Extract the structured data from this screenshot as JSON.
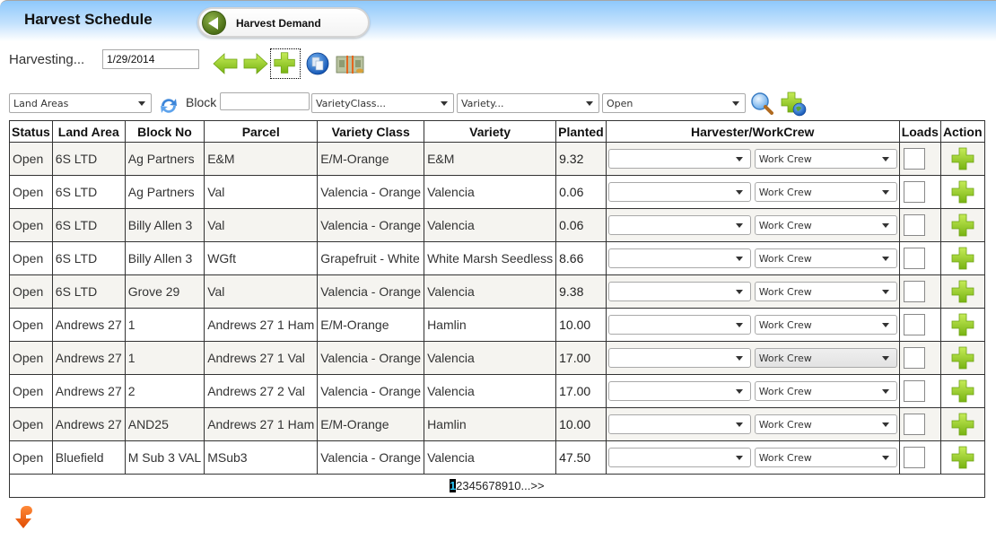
{
  "header": {
    "title": "Harvest Schedule",
    "demand_button": "Harvest Demand"
  },
  "toolbar": {
    "harvesting_label": "Harvesting...",
    "date_value": "1/29/2014",
    "icons": [
      "arrow-left-icon",
      "arrow-right-icon",
      "add-icon",
      "copy-icon",
      "money-icon"
    ]
  },
  "filters": {
    "land_areas": "Land Areas",
    "block_label": "Block",
    "block_value": "",
    "variety_class": "VarietyClass...",
    "variety": "Variety...",
    "status": "Open",
    "icons": [
      "refresh-icon",
      "search-icon",
      "add-globe-icon"
    ]
  },
  "table": {
    "columns": [
      "Status",
      "Land Area",
      "Block No",
      "Parcel",
      "Variety Class",
      "Variety",
      "Planted",
      "Harvester/WorkCrew",
      "Loads",
      "Action"
    ],
    "crew_default": "Work Crew",
    "harvester_default": "",
    "rows": [
      {
        "status": "Open",
        "land_area": "6S LTD",
        "block_no": "Ag Partners",
        "parcel": "E&M",
        "variety_class": "E/M-Orange",
        "variety": "E&M",
        "planted": "9.32"
      },
      {
        "status": "Open",
        "land_area": "6S LTD",
        "block_no": "Ag Partners",
        "parcel": "Val",
        "variety_class": "Valencia - Orange",
        "variety": "Valencia",
        "planted": "0.06"
      },
      {
        "status": "Open",
        "land_area": "6S LTD",
        "block_no": "Billy Allen 3",
        "parcel": "Val",
        "variety_class": "Valencia - Orange",
        "variety": "Valencia",
        "planted": "0.06"
      },
      {
        "status": "Open",
        "land_area": "6S LTD",
        "block_no": "Billy Allen 3",
        "parcel": "WGft",
        "variety_class": "Grapefruit - White",
        "variety": "White Marsh Seedless",
        "planted": "8.66"
      },
      {
        "status": "Open",
        "land_area": "6S LTD",
        "block_no": "Grove 29",
        "parcel": "Val",
        "variety_class": "Valencia - Orange",
        "variety": "Valencia",
        "planted": "9.38"
      },
      {
        "status": "Open",
        "land_area": "Andrews 27",
        "block_no": "1",
        "parcel": "Andrews 27 1 Ham",
        "variety_class": "E/M-Orange",
        "variety": "Hamlin",
        "planted": "10.00"
      },
      {
        "status": "Open",
        "land_area": "Andrews 27",
        "block_no": "1",
        "parcel": "Andrews 27 1 Val",
        "variety_class": "Valencia - Orange",
        "variety": "Valencia",
        "planted": "17.00"
      },
      {
        "status": "Open",
        "land_area": "Andrews 27",
        "block_no": "2",
        "parcel": "Andrews 27 2 Val",
        "variety_class": "Valencia - Orange",
        "variety": "Valencia",
        "planted": "17.00"
      },
      {
        "status": "Open",
        "land_area": "Andrews 27",
        "block_no": "AND25",
        "parcel": "Andrews 27 1 Ham",
        "variety_class": "E/M-Orange",
        "variety": "Hamlin",
        "planted": "10.00"
      },
      {
        "status": "Open",
        "land_area": "Bluefield",
        "block_no": "M Sub 3 VAL",
        "parcel": "MSub3",
        "variety_class": "Valencia - Orange",
        "variety": "Valencia",
        "planted": "47.50"
      }
    ]
  },
  "pager": {
    "pages": [
      "1",
      "2",
      "3",
      "4",
      "5",
      "6",
      "7",
      "8",
      "9",
      "10"
    ],
    "current": "1",
    "more": "...",
    "next": ">>"
  },
  "footer": {
    "icon": "download-arrow-icon"
  },
  "colors": {
    "header_gradient_top": "#8ec8fb",
    "alt_row": "#f5f4f0",
    "plus_green": "#7fbf1a",
    "pager_current_bg": "#000000",
    "pager_current_fg": "#29c6f7",
    "download_orange": "#f05a0a"
  }
}
